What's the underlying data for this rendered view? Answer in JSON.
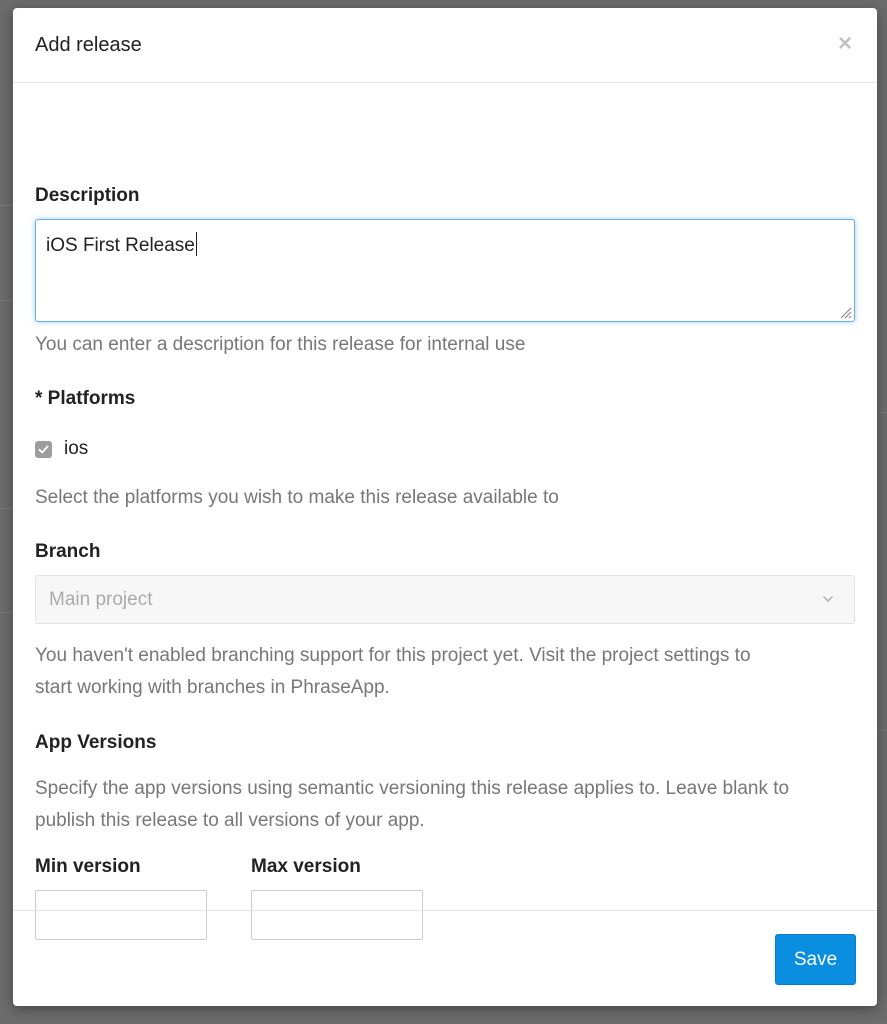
{
  "modal": {
    "title": "Add release",
    "close_glyph": "×"
  },
  "description": {
    "label": "Description",
    "value": "iOS First Release",
    "help": "You can enter a description for this release for internal use"
  },
  "platforms": {
    "label": "* Platforms",
    "options": [
      {
        "label": "ios",
        "checked": true
      }
    ],
    "help": "Select the platforms you wish to make this release available to"
  },
  "branch": {
    "label": "Branch",
    "selected": "Main project",
    "help_line1": "You haven't enabled branching support for this project yet. Visit the project settings to",
    "help_line2": "start working with branches in PhraseApp."
  },
  "app_versions": {
    "label": "App Versions",
    "help_line1": "Specify the app versions using semantic versioning this release applies to. Leave blank to",
    "help_line2": "publish this release to all versions of your app.",
    "min_label": "Min version",
    "min_value": "",
    "max_label": "Max version",
    "max_value": ""
  },
  "footer": {
    "save_label": "Save"
  },
  "colors": {
    "primary_button": "#0a8ee0",
    "focus_border": "#66afe9",
    "overlay": "#6b6b6b"
  },
  "icons": {
    "close": "close-icon",
    "check": "check-icon",
    "chevron": "chevron-down-icon",
    "resize": "resize-grip-icon"
  }
}
